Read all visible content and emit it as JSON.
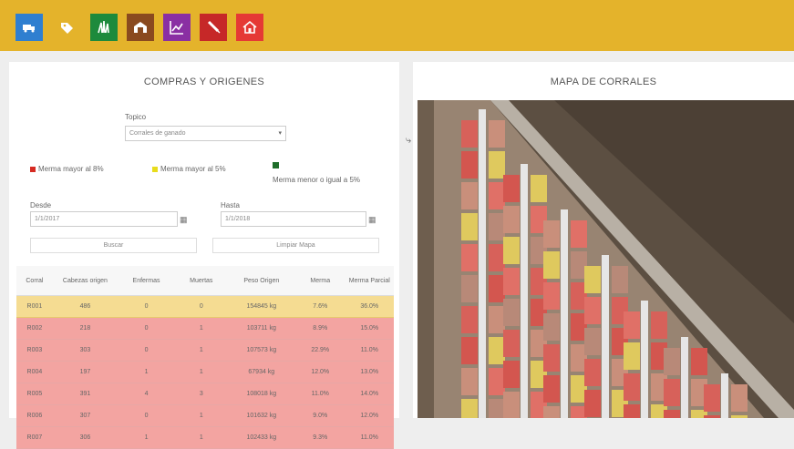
{
  "nav": [
    {
      "name": "truck",
      "color": "#2f7fd0"
    },
    {
      "name": "tag",
      "color": "#e4b32b"
    },
    {
      "name": "grass",
      "color": "#1d8a3c"
    },
    {
      "name": "barn",
      "color": "#8a4a1f"
    },
    {
      "name": "chart",
      "color": "#8a2fa3"
    },
    {
      "name": "syringe",
      "color": "#c62828"
    },
    {
      "name": "home",
      "color": "#e53935"
    }
  ],
  "left": {
    "title": "COMPRAS Y ORIGENES",
    "type_label": "Topico",
    "type_value": "Corrales de ganado",
    "legend": [
      {
        "label": "Merma mayor al 8%",
        "color": "#d62b22"
      },
      {
        "label": "Merma mayor al 5%",
        "color": "#e8dc1c"
      },
      {
        "label": "Merma menor o igual a 5%",
        "color": "#1e6e2a"
      }
    ],
    "desde_label": "Desde",
    "desde_value": "1/1/2017",
    "hasta_label": "Hasta",
    "hasta_value": "1/1/2018",
    "btn_left": "Buscar",
    "btn_right": "Limpiar Mapa"
  },
  "table": {
    "headers": [
      "Corral",
      "Cabezas origen",
      "Enfermas",
      "Muertas",
      "Peso Origen",
      "Merma",
      "Merma Parcial"
    ],
    "rows": [
      {
        "status": "yellow",
        "cells": [
          "R001",
          "486",
          "0",
          "0",
          "154845 kg",
          "7.6%",
          "36.0%"
        ]
      },
      {
        "status": "red",
        "cells": [
          "R002",
          "218",
          "0",
          "1",
          "103711 kg",
          "8.9%",
          "15.0%"
        ]
      },
      {
        "status": "red",
        "cells": [
          "R003",
          "303",
          "0",
          "1",
          "107573 kg",
          "22.9%",
          "11.0%"
        ]
      },
      {
        "status": "red",
        "cells": [
          "R004",
          "197",
          "1",
          "1",
          "67934 kg",
          "12.0%",
          "13.0%"
        ]
      },
      {
        "status": "red",
        "cells": [
          "R005",
          "391",
          "4",
          "3",
          "108018 kg",
          "11.0%",
          "14.0%"
        ]
      },
      {
        "status": "red",
        "cells": [
          "R006",
          "307",
          "0",
          "1",
          "101632 kg",
          "9.0%",
          "12.0%"
        ]
      },
      {
        "status": "red",
        "cells": [
          "R007",
          "306",
          "1",
          "1",
          "102433 kg",
          "9.3%",
          "11.0%"
        ]
      }
    ]
  },
  "right": {
    "title": "MAPA DE CORRALES"
  }
}
